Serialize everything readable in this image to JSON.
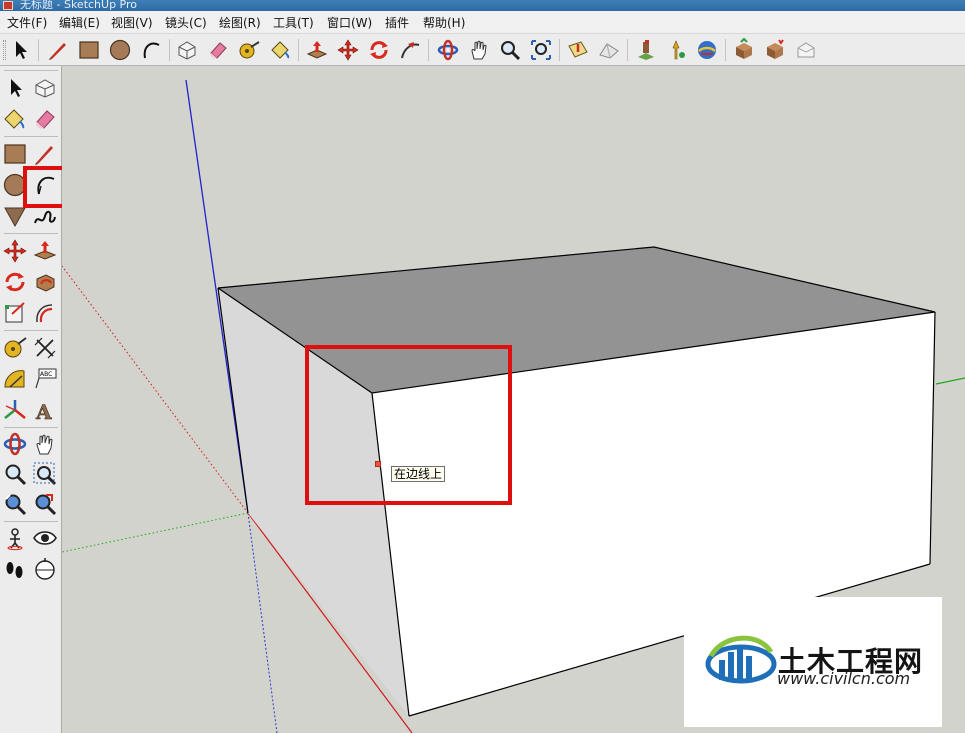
{
  "window": {
    "title": "无标题 - SketchUp Pro"
  },
  "menubar": {
    "items": [
      "文件(F)",
      "编辑(E)",
      "视图(V)",
      "镜头(C)",
      "绘图(R)",
      "工具(T)",
      "窗口(W)",
      "插件",
      "帮助(H)"
    ]
  },
  "toolbar": {
    "tools": [
      {
        "icon": "select-arrow-icon"
      },
      {
        "icon": "pencil-line-icon"
      },
      {
        "icon": "rectangle-icon"
      },
      {
        "icon": "circle-icon"
      },
      {
        "icon": "arc-icon"
      },
      {
        "icon": "make-component-icon"
      },
      {
        "icon": "eraser-icon"
      },
      {
        "icon": "tape-measure-icon"
      },
      {
        "icon": "paint-bucket-icon"
      },
      {
        "icon": "push-pull-icon"
      },
      {
        "icon": "move-icon"
      },
      {
        "icon": "rotate-icon"
      },
      {
        "icon": "follow-me-icon"
      },
      {
        "icon": "orbit-icon"
      },
      {
        "icon": "pan-hand-icon"
      },
      {
        "icon": "zoom-icon"
      },
      {
        "icon": "zoom-extents-icon"
      },
      {
        "icon": "previous-view-icon"
      },
      {
        "icon": "next-view-icon"
      },
      {
        "icon": "add-location-icon"
      },
      {
        "icon": "toggle-terrain-icon"
      },
      {
        "icon": "google-earth-icon"
      },
      {
        "icon": "get-models-icon"
      },
      {
        "icon": "share-model-icon"
      },
      {
        "icon": "share-component-icon"
      }
    ]
  },
  "left_toolbar": {
    "tools": [
      {
        "icon": "select-arrow-icon"
      },
      {
        "icon": "make-component-icon"
      },
      {
        "icon": "paint-bucket-icon"
      },
      {
        "icon": "eraser-icon"
      },
      {
        "icon": "rectangle-icon"
      },
      {
        "icon": "pencil-line-icon"
      },
      {
        "icon": "circle-icon"
      },
      {
        "icon": "arc-icon",
        "highlighted": true
      },
      {
        "icon": "polygon-icon"
      },
      {
        "icon": "freehand-icon"
      },
      {
        "icon": "move-icon"
      },
      {
        "icon": "push-pull-icon"
      },
      {
        "icon": "rotate-icon"
      },
      {
        "icon": "follow-me-icon"
      },
      {
        "icon": "scale-icon"
      },
      {
        "icon": "offset-icon"
      },
      {
        "icon": "tape-measure-icon"
      },
      {
        "icon": "dimension-icon"
      },
      {
        "icon": "protractor-icon"
      },
      {
        "icon": "text-label-icon"
      },
      {
        "icon": "axes-icon"
      },
      {
        "icon": "3d-text-icon"
      },
      {
        "icon": "orbit-icon"
      },
      {
        "icon": "pan-hand-icon"
      },
      {
        "icon": "zoom-icon"
      },
      {
        "icon": "zoom-window-icon"
      },
      {
        "icon": "previous-view-icon"
      },
      {
        "icon": "zoom-extents-icon"
      },
      {
        "icon": "position-camera-icon"
      },
      {
        "icon": "look-around-icon"
      },
      {
        "icon": "walk-icon"
      },
      {
        "icon": "section-plane-icon"
      }
    ]
  },
  "viewport": {
    "tooltip": "在边线上",
    "colors": {
      "background": "#d2d3cd",
      "top_face": "#939393",
      "left_face": "#d9d9d9",
      "front_face": "#ffffff",
      "axis_red": "#d01a1a",
      "axis_green": "#18a818",
      "axis_blue": "#2222cc",
      "highlight": "#e00f0f"
    }
  },
  "watermark": {
    "name": "土木工程网",
    "url": "www.civilcn.com"
  }
}
